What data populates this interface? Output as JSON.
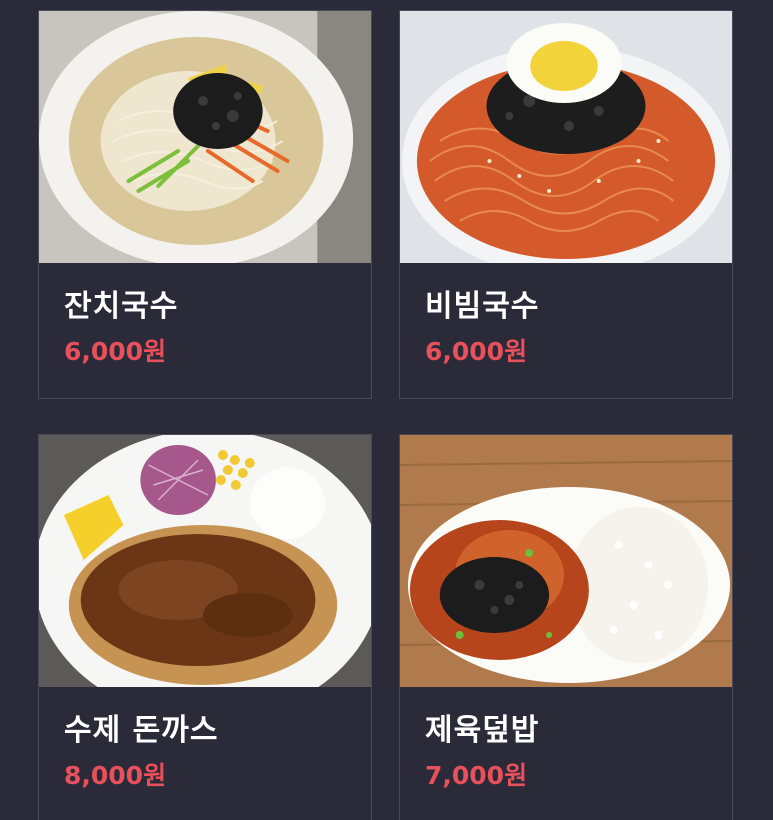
{
  "menu": {
    "items": [
      {
        "name": "잔치국수",
        "price": "6,000원",
        "image": "janchi-guksu-photo"
      },
      {
        "name": "비빔국수",
        "price": "6,000원",
        "image": "bibim-guksu-photo"
      },
      {
        "name": "수제 돈까스",
        "price": "8,000원",
        "image": "donkatsu-photo"
      },
      {
        "name": "제육덮밥",
        "price": "7,000원",
        "image": "jeyuk-deopbap-photo"
      }
    ]
  },
  "colors": {
    "background": "#2b2a38",
    "card_border": "#4a4958",
    "name_text": "#ffffff",
    "price_text": "#e8505b"
  }
}
